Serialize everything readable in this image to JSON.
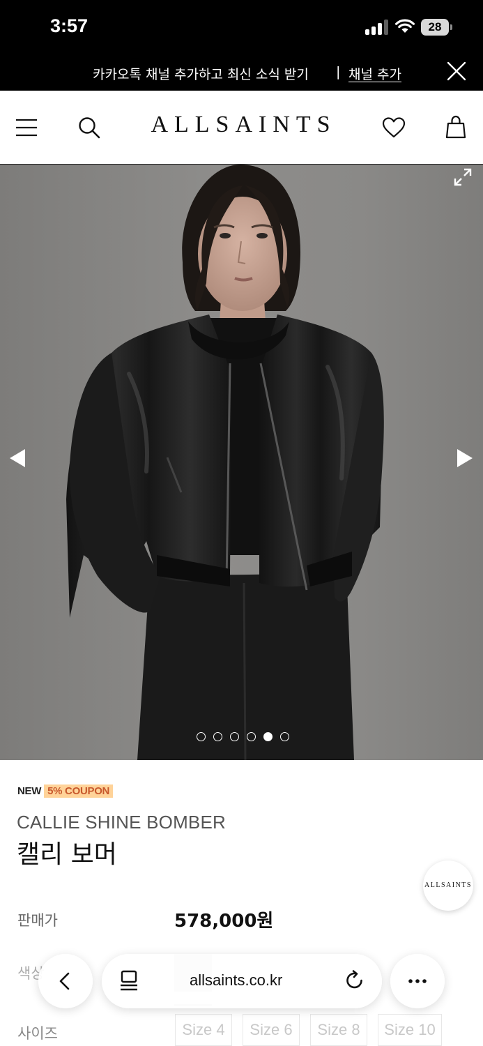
{
  "status_bar": {
    "time": "3:57",
    "battery": "28"
  },
  "promo_banner": {
    "text": "카카오톡 채널 추가하고 최신 소식 받기",
    "separator": "|",
    "link": "채널 추가"
  },
  "header": {
    "brand": "ALLSAINTS"
  },
  "gallery": {
    "image_count": 6,
    "active_index": 4
  },
  "product": {
    "badge_new": "NEW",
    "badge_coupon": "5% COUPON",
    "name_en": "CALLIE SHINE BOMBER",
    "name_ko": "캘리 보머",
    "price_label": "판매가",
    "price": "578,000원",
    "color_label": "색상",
    "size_label": "사이즈",
    "sizes": [
      "Size 4",
      "Size 6",
      "Size 8",
      "Size 10"
    ]
  },
  "floating_badge": "ALLSAINTS",
  "browser": {
    "url": "allsaints.co.kr"
  }
}
